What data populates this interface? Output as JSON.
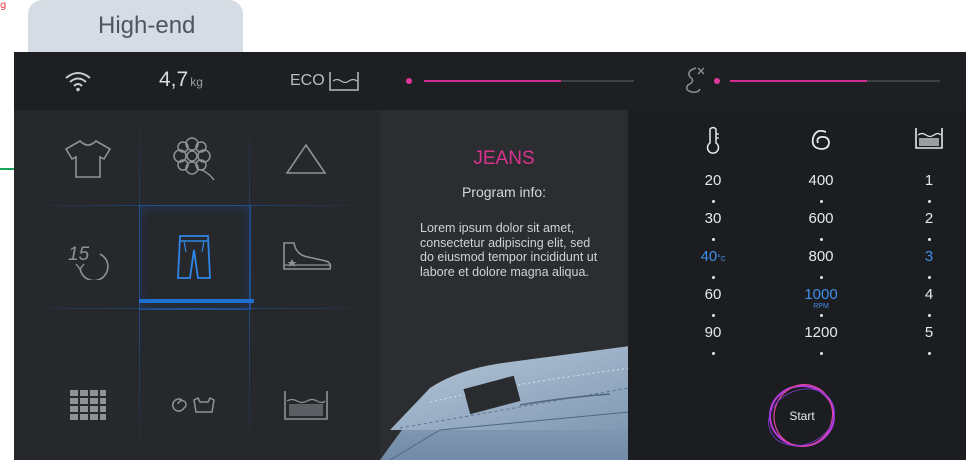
{
  "corner_mark": "g",
  "tab": {
    "label": "High-end"
  },
  "topbar": {
    "weight_value": "4,7",
    "weight_unit": "kg",
    "eco_label": "ECO",
    "eco_level": 0.65,
    "soil_level": 0.65
  },
  "programs": {
    "items": [
      {
        "icon": "shirt-icon",
        "selected": false
      },
      {
        "icon": "flower-icon",
        "selected": false
      },
      {
        "icon": "triangle-icon",
        "selected": false
      },
      {
        "icon": "quick-15-icon",
        "label": "15",
        "selected": false
      },
      {
        "icon": "jeans-icon",
        "selected": true
      },
      {
        "icon": "sneaker-icon",
        "selected": false
      },
      {
        "icon": "grid-icon",
        "selected": false
      },
      {
        "icon": "spin-wool-icon",
        "selected": false
      },
      {
        "icon": "tub-icon",
        "selected": false
      }
    ]
  },
  "info": {
    "title": "JEANS",
    "subtitle": "Program info:",
    "description": "Lorem ipsum dolor sit amet, consectetur adipiscing elit, sed do eiusmod tempor incididunt ut labore et dolore magna aliqua."
  },
  "settings": {
    "temperature": {
      "values": [
        "20",
        "30",
        "40",
        "60",
        "90"
      ],
      "selected_index": 2,
      "unit": "°c"
    },
    "spin": {
      "values": [
        "400",
        "600",
        "800",
        "1000",
        "1200"
      ],
      "selected_index": 3,
      "unit": "RPM"
    },
    "level": {
      "values": [
        "1",
        "2",
        "3",
        "4",
        "5"
      ],
      "selected_index": 2
    },
    "start_label": "Start"
  },
  "colors": {
    "accent_pink": "#d22b8f",
    "accent_blue": "#1f6fd0",
    "panel_bg": "#232528"
  }
}
